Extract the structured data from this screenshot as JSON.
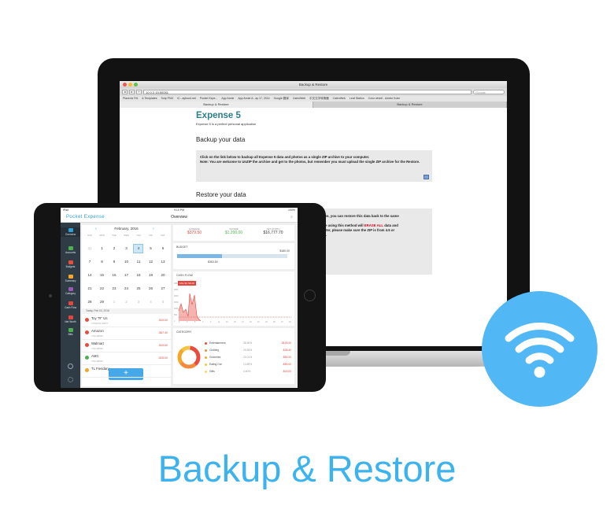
{
  "browser": {
    "window_title": "Backup & Restore",
    "url": "10.0.2.15:50081",
    "search_placeholder": "Google",
    "bookmarks": [
      "Placenix Frit",
      "& Templates",
      "Sotp PNG",
      "iC...ayfount.net",
      "Pocket Expe...",
      "App Annie",
      "App Annie A...ay 17, 2014",
      "Google 翻译",
      "CalenWeb",
      "中文汉字转换器",
      "CalenWeb",
      "Leaf Station",
      "Color wheel - Adobe Kuler"
    ],
    "tabs": [
      "Backup & Restore",
      "Backup & Restore"
    ]
  },
  "webpage": {
    "app_title": "Expense 5",
    "app_subtitle": "Expense 5 is a perfect personal application",
    "backup_heading": "Backup your data",
    "backup_line1": "Click on the link below to backup all Expense 5 data and photos as a single ZIP archive to your computer.",
    "backup_line2": "Note: You are welcome to UnZIP the archive and get to the photos, but remember you must upload the single ZIP archive for the Restore.",
    "restore_heading": "Restore your data",
    "restore_line1": "above, you can restore this data back to the same",
    "restore_line2_a": "hone using this method will",
    "restore_line2_erase": "ERASE ALL",
    "restore_line2_b": "data and",
    "restore_line3": "or later, please make sure the ZIP is from 4.5 or",
    "restore_line4": "later."
  },
  "tablet": {
    "status_left": "iPad",
    "status_time": "9:10 PM",
    "status_right": "100%",
    "brand": "Pocket Expense",
    "title": "Overview",
    "sidebar": [
      "Overview",
      "Accounts",
      "Budgets",
      "Summary",
      "Category",
      "Cash Flow",
      "Net Worth",
      "Bills"
    ],
    "calendar": {
      "month": "February, 2016",
      "prev": "‹",
      "next": "›",
      "weekdays": [
        "SUN",
        "MON",
        "TUE",
        "WED",
        "THU",
        "FRI",
        "SAT"
      ],
      "weeks": [
        [
          "31",
          "1",
          "2",
          "3",
          "4",
          "5",
          "6"
        ],
        [
          "7",
          "8",
          "9",
          "10",
          "11",
          "12",
          "13"
        ],
        [
          "14",
          "15",
          "16",
          "17",
          "18",
          "19",
          "20"
        ],
        [
          "21",
          "22",
          "23",
          "24",
          "25",
          "26",
          "27"
        ],
        [
          "28",
          "29",
          "1",
          "2",
          "3",
          "4",
          "5"
        ]
      ],
      "list_header": "Today, Feb 04, 2016",
      "transactions": [
        {
          "name": "Toy \"R\" Us",
          "sub": "CITIBANK 8##77",
          "amount": "-$19.00",
          "color": "#e94b3c"
        },
        {
          "name": "Amazon",
          "sub": "VISA #8090",
          "amount": "-$67.40",
          "color": "#e94b3c"
        },
        {
          "name": "Walmart",
          "sub": "VISA #8090",
          "amount": "-$19.60",
          "color": "#e94b3c"
        },
        {
          "name": "AMC",
          "sub": "VISA #8090",
          "amount": "-$15.00",
          "color": "#4cb050"
        },
        {
          "name": "TL Fiendary",
          "sub": "",
          "amount": "",
          "color": "#f5a623"
        }
      ],
      "add_label": "+"
    },
    "kpis": [
      {
        "label": "EXPENSE",
        "value": "$379.50",
        "color": "#e2463f"
      },
      {
        "label": "INCOME",
        "value": "$1,200.00",
        "color": "#4cb050"
      },
      {
        "label": "NET WORTH",
        "value": "$16,777.70",
        "color": "#333333"
      }
    ],
    "budget": {
      "title": "BUDGET",
      "total": "$180.00",
      "spent": "$363.50",
      "fraction": 0.41
    },
    "cashflow": {
      "title": "CASH FLOW",
      "badge": "FAIL $5,702.00",
      "y_ticks": [
        "3000",
        "2500",
        "2000",
        "1500",
        "1000",
        "500",
        "0"
      ],
      "x_ticks": [
        "1",
        "3",
        "5",
        "7",
        "9",
        "11",
        "13",
        "15",
        "17",
        "19",
        "21",
        "23",
        "25",
        "27",
        "29"
      ]
    },
    "category": {
      "title": "CATEGORY",
      "items": [
        {
          "name": "Entertainment",
          "pct": "38.50%",
          "amount": "-$100.00",
          "color": "#e94b3c"
        },
        {
          "name": "Clothing",
          "pct": "26.56%",
          "amount": "-$35.40",
          "color": "#f28c3c"
        },
        {
          "name": "Groceries",
          "pct": "23.01%",
          "amount": "-$82.00",
          "color": "#f5a623"
        },
        {
          "name": "Eating Out",
          "pct": "13.89%",
          "amount": "-$50.00",
          "color": "#f5c342"
        },
        {
          "name": "Gifts",
          "pct": "4.60%",
          "amount": "-$16.00",
          "color": "#f7d774"
        }
      ]
    }
  },
  "caption": "Backup & Restore",
  "colors": {
    "accent": "#3cb3ef",
    "wifi_badge": "#51b7f5",
    "heading_teal": "#2d7d8a",
    "erase_red": "#d0021b"
  }
}
